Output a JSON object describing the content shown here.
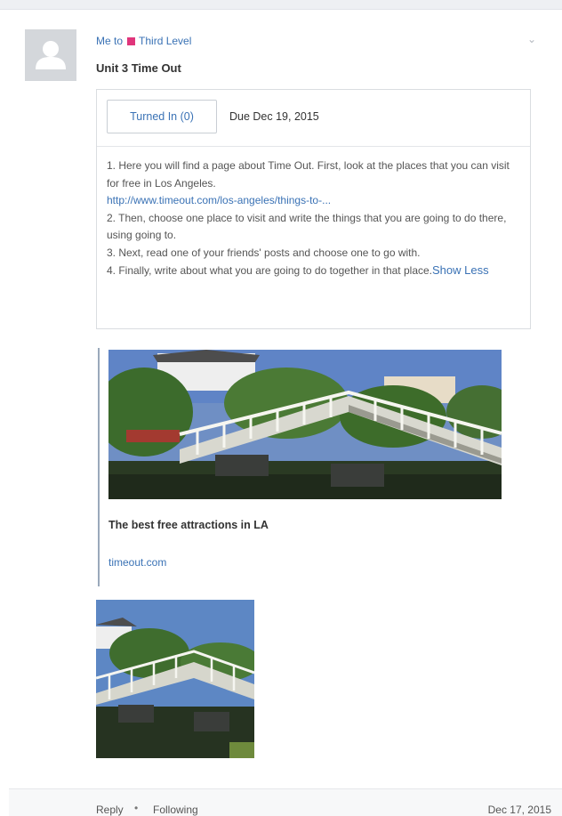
{
  "post": {
    "sender": "Me",
    "to_word": "to",
    "group": "Third Level",
    "title": "Unit 3 Time Out",
    "assignment": {
      "turned_in_label": "Turned In (0)",
      "due": "Due Dec 19, 2015",
      "lines": [
        "1. Here you will find a page about Time Out. First, look at the places that you can visit for free in Los Angeles.",
        "http://www.timeout.com/los-angeles/things-to-...",
        "2. Then, choose one place to visit and write the things that you are going to do there, using going to.",
        "3. Next, read one of your friends' posts and choose one to go with.",
        "4. Finally, write about what you are going to do together in that place."
      ],
      "show_less": "Show Less"
    },
    "link_preview": {
      "title": "The best free attractions in LA",
      "domain": "timeout.com"
    },
    "footer": {
      "reply": "Reply",
      "separator": "•",
      "following": "Following",
      "date": "Dec 17, 2015"
    }
  },
  "colors": {
    "link": "#3a72b5",
    "group_square": "#e0357b",
    "avatar_bg": "#d4d7db"
  },
  "icons": {
    "avatar": "user-silhouette-icon",
    "menu": "chevron-down-icon"
  }
}
